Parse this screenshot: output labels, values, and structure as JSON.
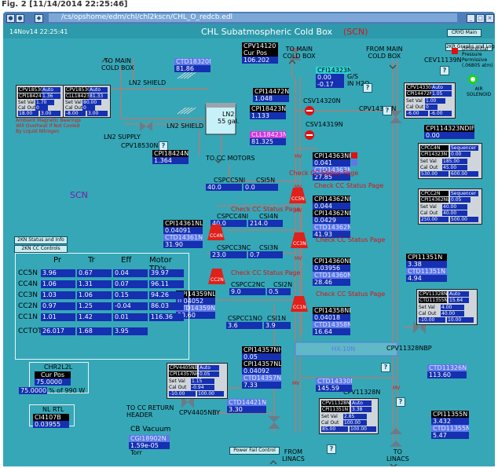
{
  "caption": "Fig. 2 [11/14/2014 22:25:46]",
  "window": {
    "path": "/cs/opshome/edm/chl/chl2kscn/CHL_O_redcb.edl"
  },
  "header": {
    "datetime": "14Nov14 22:25:41",
    "title": "CHL Subatmospheric Cold Box",
    "status": "(SCN)",
    "cryo_btn": "CRYO Main",
    "graphs_btn": "2KR Graphs and Logs"
  },
  "labels": {
    "to_main_cb_1": "TO MAIN\nCOLD BOX",
    "to_main_cb_2": "TO MAIN\nCOLD BOX",
    "from_main_cb": "FROM MAIN\nCOLD BOX",
    "ln2_shield_1": "LN2 SHIELD",
    "ln2_shield_2": "LN2 SHIELD",
    "ln2_tank": "LN2\n55 gal.",
    "ln2_supply": "LN2 SUPPLY",
    "to_cc_motors": "TO CC MOTORS",
    "gs_h2o": "G/S\nIN H2O",
    "diff_pressure": "Differential\nPressure\nPermissive\n(.06805 atm)",
    "air_solenoid": "AIR\nSOLENOID",
    "caution": "CAUTION!\nAmbient Magnetic Bearings\nWill Overheat If Not Cooled\nBy Liquid Nitrogen",
    "scn": "SCN",
    "to_cc_return": "TO CC RETURN\nHEADER",
    "from_linacs": "FROM\nLINACS",
    "to_linacs": "TO\nLINACS",
    "cb_vacuum": "CB Vacuum",
    "torr": "Torr",
    "chr2l2l": "CHR2L2L",
    "cur_pos": "Cur Pos",
    "pct_990": "% of 990 W",
    "nl_rtl": "NL RTL",
    "hx10n": "HX-10N"
  },
  "valves": {
    "cpv18530n": "CPV18530N",
    "cev11139n": "CEV11139N",
    "csv14320n": "CSV14320N",
    "csv14319n": "CSV14319N",
    "cpv14330n": "CPV14330N",
    "cpv11328n": "CPV11328N",
    "cpv11328nbp": "CPV11328NBP",
    "cpv4405nby": "CPV4405NBY"
  },
  "readouts": {
    "ctd18320n": [
      "CTD18320N",
      "81.86"
    ],
    "cpv14120": [
      "CPV14120",
      "Cur Pos",
      "106.202"
    ],
    "cpi14472n": [
      "CPI14472N",
      "1.048"
    ],
    "cpi18423n": [
      "CPI18423N",
      "1.133"
    ],
    "cll18423n": [
      "CLL18423N",
      "81.325"
    ],
    "cpi18424n": [
      "CPI18424N",
      "1.364"
    ],
    "cfi14323n": [
      "CFI14323N",
      "0.00",
      "-0.17"
    ],
    "cpi114323ndiff": [
      "CPI114323NDIFF",
      "0.00"
    ],
    "cpi14363nh": [
      "CPI14363NH",
      "0.041"
    ],
    "ctd14363nh": [
      "CTD14363NH",
      "27.85"
    ],
    "cpi14362nh": [
      "CPI14362NH",
      "0.044"
    ],
    "cpi14362nl": [
      "CPI14362NL",
      "0.0429"
    ],
    "ctd14362nl": [
      "CTD14362NL",
      "41.93"
    ],
    "cpi14361nl": [
      "CPI14361NL",
      "0.04091"
    ],
    "ctd14361nl": [
      "CTD14361NL",
      "31.90"
    ],
    "cpi14360nl": [
      "CPI14360NL",
      "0.03956"
    ],
    "ctd14360nl": [
      "CTD14360NL",
      "28.46"
    ],
    "cpi14359nl": [
      "CPI14359NL",
      "0.04052"
    ],
    "ctd14359nl": [
      "CTD14359NL",
      "23.60"
    ],
    "cpi14358nl": [
      "CPI14358NL",
      "0.04018"
    ],
    "ctd14358nl": [
      "CTD14358NL",
      "16.64"
    ],
    "cpi14357nh": [
      "CPI14357NH",
      "0.05"
    ],
    "cpi14357nl": [
      "CPI14357NL",
      "0.04092"
    ],
    "ctd14357nl": [
      "CTD14357NL",
      "7.33"
    ],
    "ctd14421n": [
      "CTD14421N",
      "3.30"
    ],
    "ctd14330n": [
      "CTD14330N",
      "145.59"
    ],
    "cpi11351n": [
      "CPI11351N",
      "3.38"
    ],
    "ctd11351n": [
      "CTD11351N",
      "4.94"
    ],
    "ctd11326n": [
      "CTD11326N",
      "113.60"
    ],
    "cpi11355n": [
      "CPI11355N",
      "3.432"
    ],
    "ctd11355n": [
      "CTD11355N",
      "5.47"
    ],
    "ci4107b": [
      "CI4107B",
      "0.03955"
    ],
    "cb_vac": [
      "CGI18902N",
      "1.59e-05"
    ],
    "chr": [
      "75.0000",
      "75.0000"
    ]
  },
  "cc": {
    "cspcc5ni": [
      "CSPCC5NI",
      "CSI5N",
      "40.0",
      "0.0"
    ],
    "cspcc4ni": [
      "CSPCC4NI",
      "CSI4N",
      "40.0",
      "214.0"
    ],
    "cspcc3nc": [
      "CSPCC3NC",
      "CSI3N",
      "23.0",
      "0.7"
    ],
    "cspcc2nc": [
      "CSPCC2NC",
      "CSI2N",
      "9.0",
      "0.5"
    ],
    "cspcc1no": [
      "CSPCC1NO",
      "CSI1N",
      "3.6",
      "3.9"
    ],
    "check": "Check CC Status Page",
    "names": [
      "CC5N",
      "CC4N",
      "CC3N",
      "CC2N",
      "CC1N"
    ]
  },
  "controllers": {
    "c1": {
      "title": "CPV18530NA",
      "mode": "Auto",
      "sp_lbl": "CPI18424N",
      "sp": "1.36",
      "set": "1.70",
      "out": "18.00",
      "lo": "3.00",
      "hi": "0"
    },
    "c2": {
      "title": "CPV18530NL",
      "mode": "Auto",
      "sp_lbl": "CLL18423N",
      "sp": "81.33",
      "set": "80.00",
      "out": "-8.00",
      "lo": "3.00",
      "hi": "0"
    },
    "c3": {
      "title": "CPV14330N",
      "mode": "Auto",
      "sp_lbl": "CPI14472N",
      "sp": "1.05",
      "set": "1.00",
      "out": "-6.00",
      "lo": "-6.00",
      "hi": "0"
    },
    "c4": {
      "title": "CPCC4N",
      "mode": "Sequencer",
      "sp_lbl": "CPI14323N",
      "sp": "0.00",
      "set": "185.00",
      "out": "45.00",
      "lo": "530.00",
      "hi": "600.00"
    },
    "c5": {
      "title": "CPCC2N",
      "mode": "Sequencer",
      "sp_lbl": "CPI14362NL",
      "sp": "0.05",
      "set": "40.00",
      "out": "40.00",
      "lo": "250.00",
      "hi": "500.00"
    },
    "c6": {
      "title": "CPV11328N",
      "mode": "Auto",
      "sp_lbl": "CTD11355N",
      "sp": "15.64",
      "set": "4.00",
      "out": "40.00",
      "lo": "-10.00",
      "hi": "10.00"
    },
    "c7": {
      "title": "CPV4405NBY",
      "mode": "Auto",
      "sp_lbl": "CPI14357NH",
      "sp": "0.05",
      "set": "1.15",
      "out": "-0.94",
      "lo": "-10.00",
      "hi": "100.00"
    },
    "c8": {
      "title": "CPV11328N",
      "mode": "Auto",
      "sp_lbl": "CPI11351N",
      "sp": "3.38",
      "set": "2.85",
      "out": "100.00",
      "lo": "85.00",
      "hi": "100.00"
    }
  },
  "ctl_labels": {
    "set": "Set Val",
    "out": "Cal Out"
  },
  "buttons": {
    "status_info": "2KN Status and Info",
    "cc_controls": "2KN CC Controls",
    "power_fail": "Power Fail Control"
  },
  "table": {
    "headers": [
      "Pr",
      "Tr",
      "Eff",
      "Motor TD's"
    ],
    "rows": [
      {
        "name": "CC5N",
        "v": [
          "3.96",
          "0.67",
          "0.04",
          "39.97"
        ]
      },
      {
        "name": "CC4N",
        "v": [
          "1.06",
          "1.31",
          "0.07",
          "96.11"
        ]
      },
      {
        "name": "CC3N",
        "v": [
          "1.03",
          "1.06",
          "0.15",
          "94.26"
        ]
      },
      {
        "name": "CC2N",
        "v": [
          "0.97",
          "1.25",
          "-0.04",
          "86.03"
        ]
      },
      {
        "name": "CC1N",
        "v": [
          "1.01",
          "1.42",
          "0.01",
          "116.36"
        ]
      }
    ],
    "total": {
      "name": "CCTOT",
      "v": [
        "26.017",
        "1.68",
        "3.95"
      ]
    }
  },
  "colors": {
    "bg": "#36a7b7",
    "readout_bg": "#000000",
    "value_bg": "#1530b0",
    "compressor": "#e0201a",
    "pipe": "#8a8a8a"
  }
}
